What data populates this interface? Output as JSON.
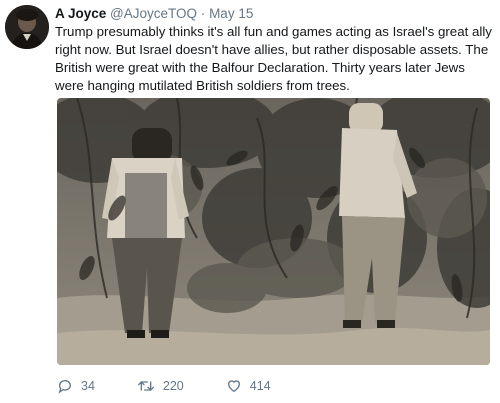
{
  "tweet": {
    "author_name": "A Joyce",
    "handle": "@AJoyceTOQ",
    "separator": "·",
    "date": "May 15",
    "text": "Trump presumably thinks it's all fun and games acting as Israel's great ally right now. But Israel doesn't have allies, but rather disposable assets. The British were great with the Balfour Declaration. Thirty years later Jews were hanging mutilated British soldiers from trees.",
    "avatar_icon": "portrait-avatar",
    "photo_icon": "sepia-photo-men-hanging-from-trees"
  },
  "actions": {
    "replies": "34",
    "retweets": "220",
    "likes": "414",
    "reply_icon": "reply-icon",
    "retweet_icon": "retweet-icon",
    "like_icon": "heart-icon"
  }
}
